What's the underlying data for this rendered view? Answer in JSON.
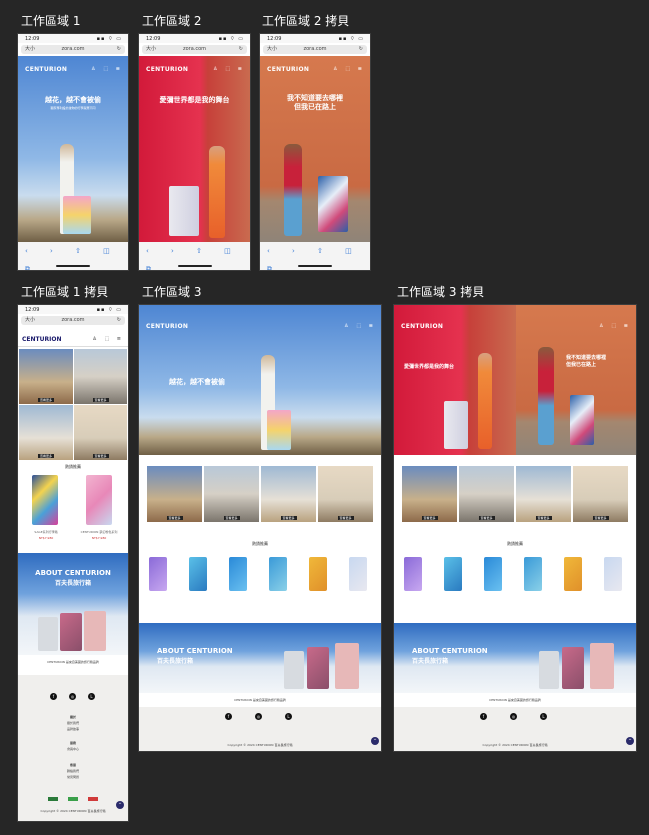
{
  "artboards": {
    "a1": {
      "label": "工作區域 1"
    },
    "a2": {
      "label": "工作區域 2"
    },
    "a3": {
      "label": "工作區域 2 拷貝"
    },
    "a4": {
      "label": "工作區域 1 拷貝"
    },
    "a5": {
      "label": "工作區域 3"
    },
    "a6": {
      "label": "工作區域 3 拷貝"
    }
  },
  "phone": {
    "time": "12:09",
    "signal": "▪▪ ⌔ ▭",
    "aa": "大小",
    "url": "zora.com",
    "reload": "↻",
    "logo": "CENTURION",
    "header_icons": "♙ ⬚ ≡",
    "toolbar_icons": "‹ › ⇧ ◫ ⧉"
  },
  "hero": {
    "line1": "越花，越不會被偷",
    "sub1": "獨家專利設計讓你的行李與眾不同",
    "line2": "愛彌世界都是我的舞台",
    "line3a": "我不知道要去哪裡",
    "line3b": "但我已在路上",
    "desktop_line1": "越花，越不會被偷",
    "desktop_line2a": "我不知道要去哪裡",
    "desktop_line2b": "但我已在路上",
    "desktop_line2c": "愛彌世界都是我的舞台"
  },
  "tiles": {
    "t1": "查看更多",
    "t2": "查看更多",
    "t3": "查看更多",
    "t4": "查看更多"
  },
  "products": {
    "title": "熱銷推薦",
    "p1": "SAGE系列行李箱",
    "p1price": "NT$7,980",
    "p2": "CENTURION 夢幻粉色系列",
    "p2price": "NT$7,980"
  },
  "about": {
    "title": "ABOUT CENTURION",
    "subtitle": "百夫長旅行箱",
    "line": "CENTURION 是來自美國的旅行箱品牌"
  },
  "footer": {
    "social_fb": "f",
    "social_ig": "◎",
    "social_line": "L",
    "h1": "關於",
    "h1a": "關於我們",
    "h1b": "品牌故事",
    "h2": "服務",
    "h2a": "會員中心",
    "h3": "客服",
    "h3a": "聯絡我們",
    "h3b": "常見問題",
    "copyright": "Copyright © 2024 CENTURION 百夫長旅行箱",
    "fab": "^"
  },
  "colors": {
    "canvas": "#262626",
    "accent": "#2b2b6b"
  }
}
